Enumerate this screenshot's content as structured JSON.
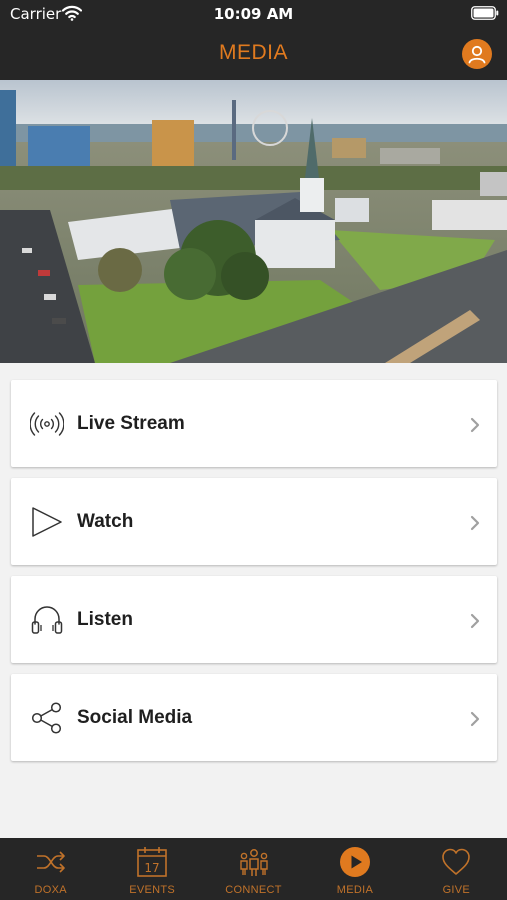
{
  "status_bar": {
    "carrier": "Carrier",
    "time": "10:09 AM"
  },
  "nav": {
    "title": "MEDIA",
    "profile_icon": "person-icon"
  },
  "hero": {
    "icon": "aerial-church-photo"
  },
  "menu": {
    "items": [
      {
        "label": "Live Stream",
        "icon": "broadcast-icon"
      },
      {
        "label": "Watch",
        "icon": "play-outline-icon"
      },
      {
        "label": "Listen",
        "icon": "headphones-icon"
      },
      {
        "label": "Social Media",
        "icon": "share-icon"
      }
    ]
  },
  "tabs": [
    {
      "label": "DOXA",
      "icon": "shuffle-icon"
    },
    {
      "label": "EVENTS",
      "icon": "calendar-icon",
      "calendar_day": "17"
    },
    {
      "label": "CONNECT",
      "icon": "group-icon"
    },
    {
      "label": "MEDIA",
      "icon": "play-circle-icon",
      "active": true
    },
    {
      "label": "GIVE",
      "icon": "heart-icon"
    }
  ],
  "colors": {
    "accent": "#e07a1f",
    "bar_background": "#262626",
    "page_background": "#f2f2f2"
  }
}
